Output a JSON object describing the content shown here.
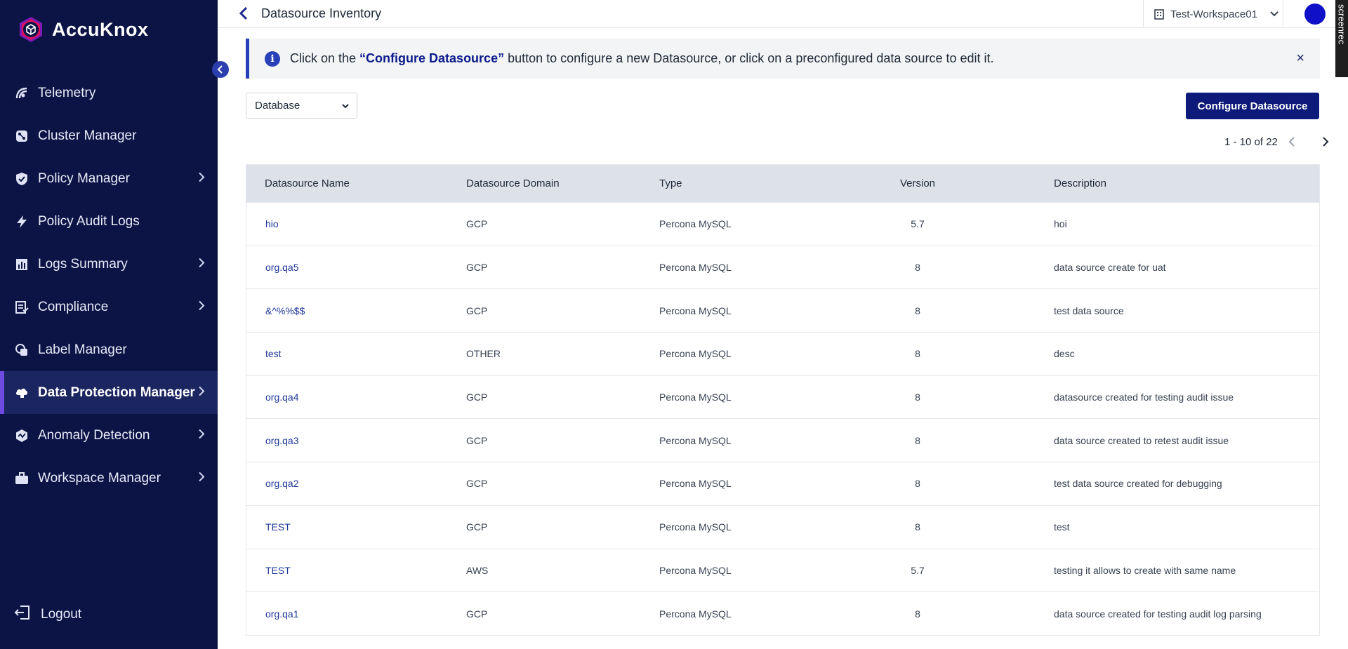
{
  "app": {
    "brand": "AccuKnox"
  },
  "sidebar": {
    "items": [
      {
        "label": "Telemetry",
        "icon": "telemetry-icon",
        "chevron": false
      },
      {
        "label": "Cluster Manager",
        "icon": "cluster-icon",
        "chevron": false
      },
      {
        "label": "Policy Manager",
        "icon": "shield-icon",
        "chevron": true
      },
      {
        "label": "Policy Audit Logs",
        "icon": "bolt-icon",
        "chevron": false
      },
      {
        "label": "Logs Summary",
        "icon": "bar-chart-icon",
        "chevron": true
      },
      {
        "label": "Compliance",
        "icon": "checklist-icon",
        "chevron": true
      },
      {
        "label": "Label Manager",
        "icon": "label-icon",
        "chevron": false
      },
      {
        "label": "Data Protection Manager",
        "icon": "cloud-lock-icon",
        "chevron": true,
        "active": true
      },
      {
        "label": "Anomaly Detection",
        "icon": "anomaly-icon",
        "chevron": true
      },
      {
        "label": "Workspace Manager",
        "icon": "briefcase-icon",
        "chevron": true
      }
    ],
    "logout_label": "Logout"
  },
  "header": {
    "title": "Datasource Inventory",
    "workspace": "Test-Workspace01",
    "rec_label": "screenrec"
  },
  "banner": {
    "prefix": "Click on the ",
    "highlight": "“Configure Datasource”",
    "suffix": " button to configure a new Datasource, or click on a preconfigured data source to edit it.",
    "info_glyph": "i",
    "close_glyph": "×"
  },
  "filter": {
    "selected": "Database"
  },
  "actions": {
    "configure_label": "Configure Datasource"
  },
  "pagination": {
    "range_text": "1 - 10 of 22"
  },
  "table": {
    "columns": [
      "Datasource Name",
      "Datasource Domain",
      "Type",
      "Version",
      "Description"
    ],
    "rows": [
      [
        "hio",
        "GCP",
        "Percona MySQL",
        "5.7",
        "hoi"
      ],
      [
        "org.qa5",
        "GCP",
        "Percona MySQL",
        "8",
        "data source create for uat"
      ],
      [
        "&^%%$$",
        "GCP",
        "Percona MySQL",
        "8",
        "test data source"
      ],
      [
        "test",
        "OTHER",
        "Percona MySQL",
        "8",
        "desc"
      ],
      [
        "org.qa4",
        "GCP",
        "Percona MySQL",
        "8",
        "datasource created for testing audit issue"
      ],
      [
        "org.qa3",
        "GCP",
        "Percona MySQL",
        "8",
        "data source created to retest audit issue"
      ],
      [
        "org.qa2",
        "GCP",
        "Percona MySQL",
        "8",
        "test data source created for debugging"
      ],
      [
        "TEST",
        "GCP",
        "Percona MySQL",
        "8",
        "test"
      ],
      [
        "TEST",
        "AWS",
        "Percona MySQL",
        "5.7",
        "testing it allows to create with same name"
      ],
      [
        "org.qa1",
        "GCP",
        "Percona MySQL",
        "8",
        "data source created for testing audit log parsing"
      ]
    ]
  },
  "colors": {
    "sidebar_bg": "#0b1445",
    "accent": "#0d1a7a",
    "active_bar": "#6d4be0",
    "link": "#1e3799"
  }
}
